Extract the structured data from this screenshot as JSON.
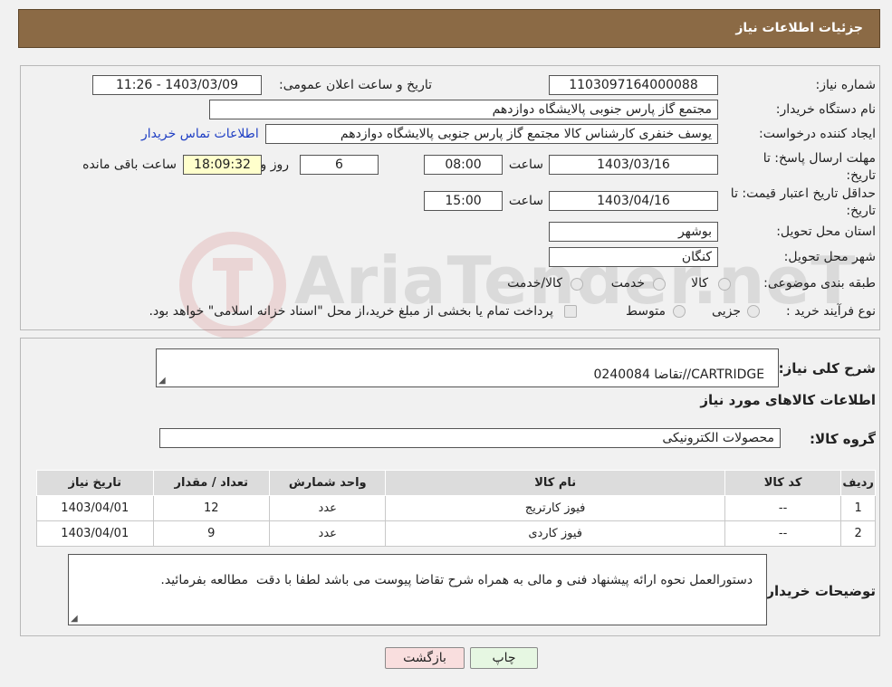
{
  "header": {
    "title": "جزئیات اطلاعات نیاز"
  },
  "form": {
    "need_number": {
      "label": "شماره نیاز:",
      "value": "1103097164000088"
    },
    "announce_datetime": {
      "label": "تاریخ و ساعت اعلان عمومی:",
      "value": "1403/03/09 - 11:26"
    },
    "buyer_org": {
      "label": "نام دستگاه خریدار:",
      "value": "مجتمع گاز پارس جنوبی  پالایشگاه دوازدهم"
    },
    "requester": {
      "label": "ایجاد کننده درخواست:",
      "value": "یوسف خنفری کارشناس کالا مجتمع گاز پارس جنوبی  پالایشگاه دوازدهم",
      "contact_link": "اطلاعات تماس خریدار"
    },
    "reply_deadline": {
      "label": "مهلت ارسال پاسخ: تا تاریخ:",
      "date": "1403/03/16",
      "time_label": "ساعت",
      "time": "08:00",
      "days": "6",
      "days_label": "روز و",
      "remaining": "18:09:32",
      "remaining_label": "ساعت باقی مانده"
    },
    "price_validity": {
      "label": "حداقل تاریخ اعتبار قیمت: تا تاریخ:",
      "date": "1403/04/16",
      "time_label": "ساعت",
      "time": "15:00"
    },
    "province": {
      "label": "استان محل تحویل:",
      "value": "بوشهر"
    },
    "city": {
      "label": "شهر محل تحویل:",
      "value": "کنگان"
    },
    "category": {
      "label": "طبقه بندی موضوعی:",
      "options": [
        "کالا",
        "خدمت",
        "کالا/خدمت"
      ]
    },
    "purchase_type": {
      "label": "نوع فرآیند خرید :",
      "options": [
        "جزیی",
        "متوسط"
      ],
      "note": "پرداخت تمام یا بخشی از مبلغ خرید،از محل \"اسناد خزانه اسلامی\" خواهد بود."
    }
  },
  "description": {
    "label": "شرح کلی نیاز:",
    "value": "CARTRIDGE//تقاضا 0240084"
  },
  "goods_section": {
    "title": "اطلاعات کالاهای مورد نیاز",
    "group_label": "گروه کالا:",
    "group_value": "محصولات الکترونیکی",
    "columns": [
      "ردیف",
      "کد کالا",
      "نام کالا",
      "واحد شمارش",
      "تعداد / مقدار",
      "تاریخ نیاز"
    ],
    "rows": [
      [
        "1",
        "--",
        "فیوز کارتریج",
        "عدد",
        "12",
        "1403/04/01"
      ],
      [
        "2",
        "--",
        "فیوز کاردی",
        "عدد",
        "9",
        "1403/04/01"
      ]
    ]
  },
  "buyer_notes": {
    "label": "توضیحات خریدار:",
    "value": "دستورالعمل نحوه ارائه پیشنهاد فنی و مالی به همراه شرح تقاضا پیوست می باشد لطفا با دقت  مطالعه بفرمائید."
  },
  "buttons": {
    "print": "چاپ",
    "back": "بازگشت"
  },
  "colors": {
    "header": "#8b6a45",
    "back_button": "#f9dede",
    "print_button": "#e6f7e2"
  },
  "watermark": {
    "text": "AriaTender.neT"
  }
}
